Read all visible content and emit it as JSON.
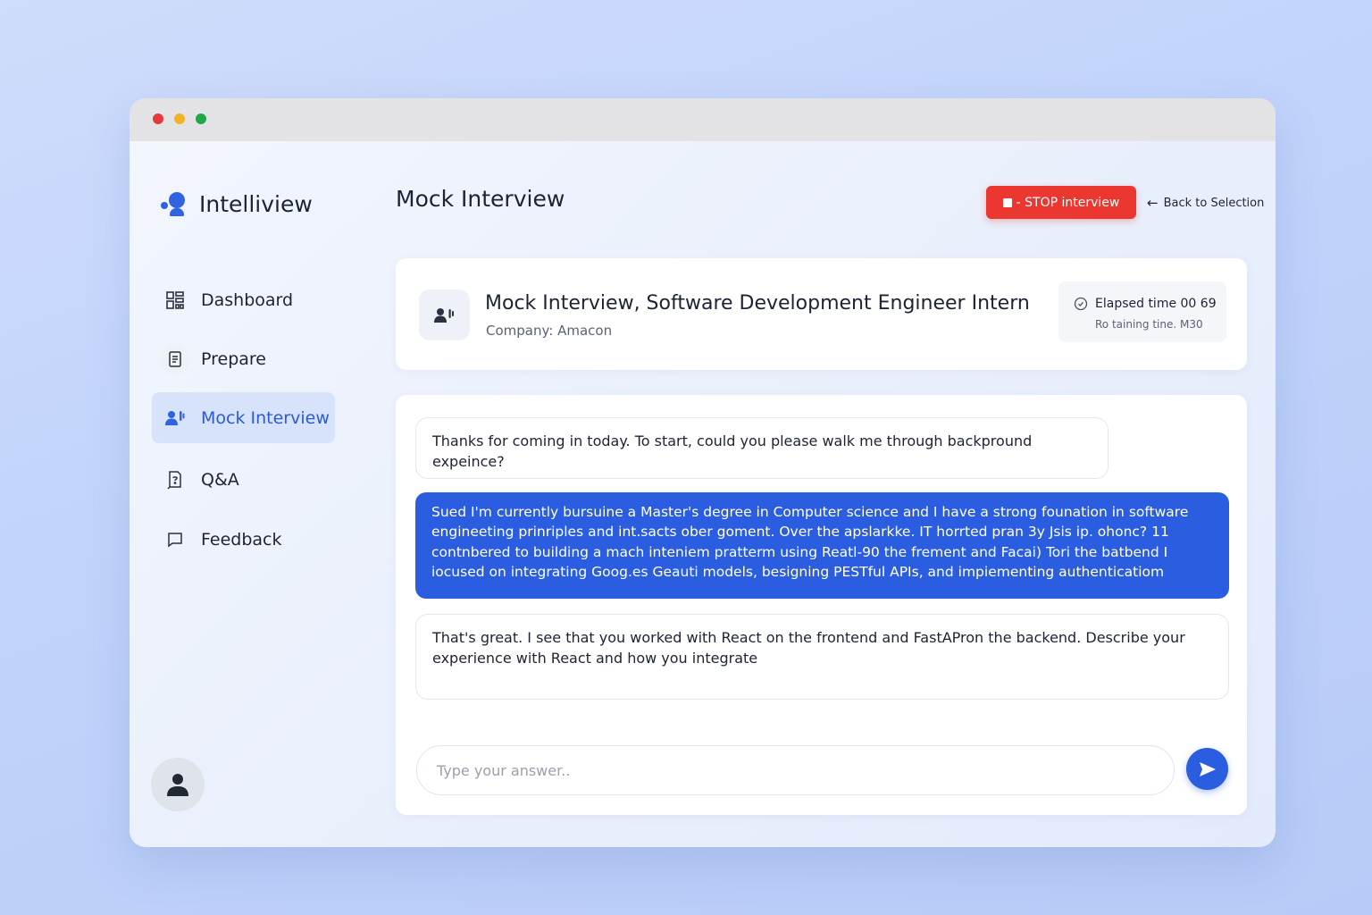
{
  "app": {
    "name": "Intelliview"
  },
  "sidebar": {
    "items": [
      {
        "label": "Dashboard",
        "icon": "dashboard-icon"
      },
      {
        "label": "Prepare",
        "icon": "document-icon"
      },
      {
        "label": "Mock Interview",
        "icon": "interview-icon",
        "active": true
      },
      {
        "label": "Q&A",
        "icon": "qa-icon"
      },
      {
        "label": "Feedback",
        "icon": "chat-bubble-icon"
      }
    ]
  },
  "header": {
    "title": "Mock Interview",
    "stop_label": "- STOP interview",
    "back_label": "Back to Selection"
  },
  "session": {
    "title": "Mock Interview, Software Development Engineer Intern",
    "company": "Company: Amacon",
    "elapsed": "Elapsed time 00 69",
    "remaining": "Ro  taining tine. M30"
  },
  "chat": {
    "messages": [
      {
        "role": "interviewer",
        "text": "Thanks for coming in today. To start, could you please walk me through backpround expeince?"
      },
      {
        "role": "candidate",
        "text": "Sued I'm currently bursuine a Master's degree in Computer  science  and I have a strong founation in software engineeting prinriples and int.sacts ober goment. Over the apslarkke. IT horrted pran 3y Jsis ip. ohonc?  11 contnbered to building a mach inteniem pratterm using Reatl-90 the frement  and Facai) Tori the batbend  I iocused on integrating Goog.es Geauti models, besigning PESTful APIs, and impiementing authenticatiom"
      },
      {
        "role": "interviewer",
        "text": "That's great. I see that you worked with React on the frontend and FastAPron the backend. Describe your experience with React and how you integrate"
      }
    ],
    "input_placeholder": "Type your answer.."
  },
  "colors": {
    "accent": "#2a5de0",
    "stop": "#ec3730",
    "active_nav_bg": "#d7e3fb"
  }
}
